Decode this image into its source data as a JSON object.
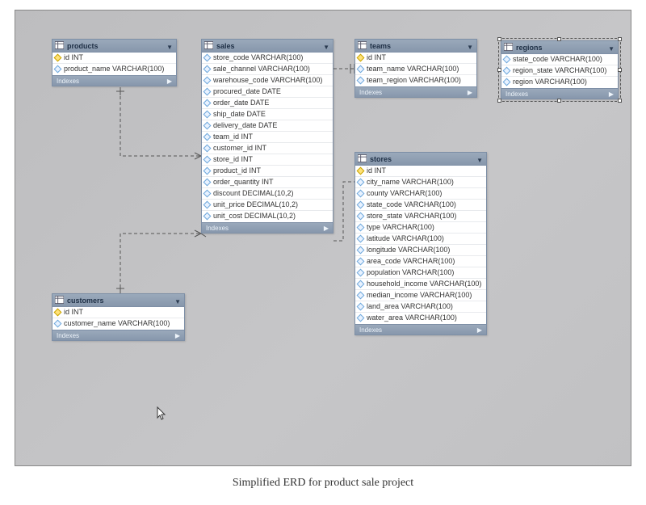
{
  "caption": "Simplified ERD for product sale project",
  "entities": {
    "products": {
      "title": "products",
      "indexes_label": "Indexes",
      "columns": [
        {
          "name": "id INT",
          "kind": "key"
        },
        {
          "name": "product_name VARCHAR(100)",
          "kind": "attr"
        }
      ]
    },
    "sales": {
      "title": "sales",
      "indexes_label": "Indexes",
      "columns": [
        {
          "name": "store_code VARCHAR(100)",
          "kind": "attr"
        },
        {
          "name": "sale_channel VARCHAR(100)",
          "kind": "attr"
        },
        {
          "name": "warehouse_code VARCHAR(100)",
          "kind": "attr"
        },
        {
          "name": "procured_date DATE",
          "kind": "attr"
        },
        {
          "name": "order_date DATE",
          "kind": "attr"
        },
        {
          "name": "ship_date DATE",
          "kind": "attr"
        },
        {
          "name": "delivery_date DATE",
          "kind": "attr"
        },
        {
          "name": "team_id INT",
          "kind": "attr"
        },
        {
          "name": "customer_id INT",
          "kind": "attr"
        },
        {
          "name": "store_id INT",
          "kind": "attr"
        },
        {
          "name": "product_id INT",
          "kind": "attr"
        },
        {
          "name": "order_quantity INT",
          "kind": "attr"
        },
        {
          "name": "discount DECIMAL(10,2)",
          "kind": "attr"
        },
        {
          "name": "unit_price DECIMAL(10,2)",
          "kind": "attr"
        },
        {
          "name": "unit_cost DECIMAL(10,2)",
          "kind": "attr"
        }
      ]
    },
    "teams": {
      "title": "teams",
      "indexes_label": "Indexes",
      "columns": [
        {
          "name": "id INT",
          "kind": "key"
        },
        {
          "name": "team_name VARCHAR(100)",
          "kind": "attr"
        },
        {
          "name": "team_region VARCHAR(100)",
          "kind": "attr"
        }
      ]
    },
    "regions": {
      "title": "regions",
      "indexes_label": "Indexes",
      "columns": [
        {
          "name": "state_code VARCHAR(100)",
          "kind": "attr"
        },
        {
          "name": "region_state VARCHAR(100)",
          "kind": "attr"
        },
        {
          "name": "region VARCHAR(100)",
          "kind": "attr"
        }
      ]
    },
    "customers": {
      "title": "customers",
      "indexes_label": "Indexes",
      "columns": [
        {
          "name": "id INT",
          "kind": "key"
        },
        {
          "name": "customer_name VARCHAR(100)",
          "kind": "attr"
        }
      ]
    },
    "stores": {
      "title": "stores",
      "indexes_label": "Indexes",
      "columns": [
        {
          "name": "id INT",
          "kind": "key"
        },
        {
          "name": "city_name VARCHAR(100)",
          "kind": "attr"
        },
        {
          "name": "county VARCHAR(100)",
          "kind": "attr"
        },
        {
          "name": "state_code VARCHAR(100)",
          "kind": "attr"
        },
        {
          "name": "store_state VARCHAR(100)",
          "kind": "attr"
        },
        {
          "name": "type VARCHAR(100)",
          "kind": "attr"
        },
        {
          "name": "latitude VARCHAR(100)",
          "kind": "attr"
        },
        {
          "name": "longitude VARCHAR(100)",
          "kind": "attr"
        },
        {
          "name": "area_code VARCHAR(100)",
          "kind": "attr"
        },
        {
          "name": "population VARCHAR(100)",
          "kind": "attr"
        },
        {
          "name": "household_income VARCHAR(100)",
          "kind": "attr"
        },
        {
          "name": "median_income VARCHAR(100)",
          "kind": "attr"
        },
        {
          "name": "land_area VARCHAR(100)",
          "kind": "attr"
        },
        {
          "name": "water_area VARCHAR(100)",
          "kind": "attr"
        }
      ]
    }
  }
}
